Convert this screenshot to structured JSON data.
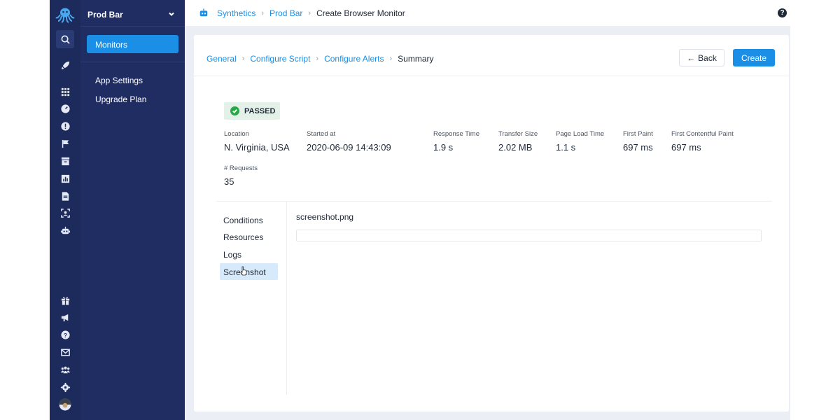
{
  "app": {
    "name": "Prod Bar"
  },
  "rail": {
    "icons": [
      "octopus-logo-icon",
      "search-icon",
      "rocket-icon",
      "grid-icon",
      "dashboard-icon",
      "alert-icon",
      "flag-icon",
      "inbox-icon",
      "chart-icon",
      "document-icon",
      "scan-icon",
      "robot-icon",
      "gift-icon",
      "megaphone-icon",
      "help-icon",
      "mail-icon",
      "team-icon",
      "gear-icon",
      "avatar"
    ]
  },
  "sidebar": {
    "title": "Prod Bar",
    "active_item": "Monitors",
    "items": [
      "App Settings",
      "Upgrade Plan"
    ]
  },
  "topbar": {
    "breadcrumbs": [
      "Synthetics",
      "Prod Bar"
    ],
    "current": "Create Browser Monitor",
    "help_glyph": "?"
  },
  "wizard": {
    "steps": [
      "General",
      "Configure Script",
      "Configure Alerts"
    ],
    "current_step": "Summary",
    "back_label": "Back",
    "back_arrow": "←",
    "create_label": "Create"
  },
  "result": {
    "status": "PASSED",
    "metrics": [
      {
        "label": "Location",
        "value": "N. Virginia, USA"
      },
      {
        "label": "Started at",
        "value": "2020-06-09 14:43:09"
      },
      {
        "label": "Response Time",
        "value": "1.9 s"
      },
      {
        "label": "Transfer Size",
        "value": "2.02 MB"
      },
      {
        "label": "Page Load Time",
        "value": "1.1 s"
      },
      {
        "label": "First Paint",
        "value": "697 ms"
      },
      {
        "label": "First Contentful Paint",
        "value": "697 ms"
      },
      {
        "label": "# Requests",
        "value": "35"
      }
    ]
  },
  "detail_tabs": [
    "Conditions",
    "Resources",
    "Logs",
    "Screenshot"
  ],
  "active_tab": "Screenshot",
  "screenshot": {
    "filename": "screenshot.png"
  },
  "colors": {
    "rail": "#1d2a5c",
    "sidebar": "#1f2d63",
    "accent": "#1b8fe6",
    "passed": "#27a745"
  }
}
